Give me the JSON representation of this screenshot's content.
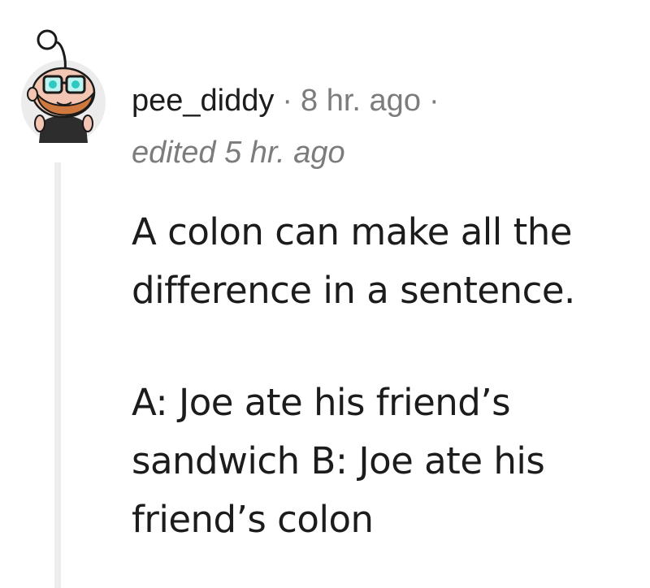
{
  "comment": {
    "author": "pee_diddy",
    "separator": "·",
    "posted_time": "8 hr. ago",
    "edited_label": "edited 5 hr. ago",
    "paragraphs": [
      "A colon can make all the difference in a sentence.",
      "A: Joe ate his friend’s sandwich B: Joe ate his friend’s colon"
    ]
  },
  "avatar": {
    "icon": "snoo-avatar-icon",
    "colors": {
      "skin": "#f3c6b3",
      "beard": "#d0793f",
      "glasses": "#2fc9c1",
      "shirt": "#2d2d2d",
      "background": "#ececec"
    }
  }
}
